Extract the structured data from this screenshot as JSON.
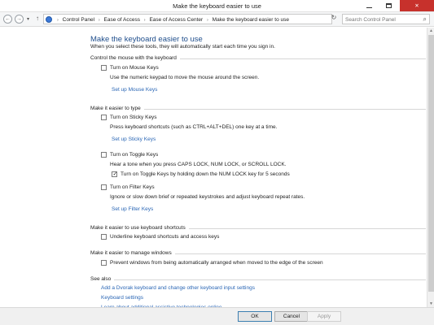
{
  "window": {
    "title": "Make the keyboard easier to use",
    "close_glyph": "✕"
  },
  "addressbar": {
    "back_glyph": "←",
    "forward_glyph": "→",
    "recent_glyph": "▾",
    "up_glyph": "↑",
    "breadcrumbs": [
      "Control Panel",
      "Ease of Access",
      "Ease of Access Center",
      "Make the keyboard easier to use"
    ],
    "separator": "›",
    "drop_glyph": "▾",
    "refresh_glyph": "↻",
    "search_placeholder": "Search Control Panel",
    "search_glyph": "⌕"
  },
  "page": {
    "title": "Make the keyboard easier to use",
    "subtitle": "When you select these tools, they will automatically start each time you sign in."
  },
  "sections": {
    "mouse": {
      "heading": "Control the mouse with the keyboard",
      "mouse_keys": {
        "label": "Turn on Mouse Keys",
        "checked": false
      },
      "mouse_keys_desc": "Use the numeric keypad to move the mouse around the screen.",
      "mouse_keys_link": "Set up Mouse Keys"
    },
    "typing": {
      "heading": "Make it easier to type",
      "sticky_keys": {
        "label": "Turn on Sticky Keys",
        "checked": false
      },
      "sticky_keys_desc": "Press keyboard shortcuts (such as CTRL+ALT+DEL) one key at a time.",
      "sticky_keys_link": "Set up Sticky Keys",
      "toggle_keys": {
        "label": "Turn on Toggle Keys",
        "checked": false
      },
      "toggle_keys_desc": "Hear a tone when you press CAPS LOCK, NUM LOCK, or SCROLL LOCK.",
      "toggle_keys_hold": {
        "label": "Turn on Toggle Keys by holding down the NUM LOCK key for 5 seconds",
        "checked": true
      },
      "filter_keys": {
        "label": "Turn on Filter Keys",
        "checked": false
      },
      "filter_keys_desc": "Ignore or slow down brief or repeated keystrokes and adjust keyboard repeat rates.",
      "filter_keys_link": "Set up Filter Keys"
    },
    "shortcuts": {
      "heading": "Make it easier to use keyboard shortcuts",
      "underline": {
        "label": "Underline keyboard shortcuts and access keys",
        "checked": false
      }
    },
    "windows": {
      "heading": "Make it easier to manage windows",
      "prevent_arrange": {
        "label": "Prevent windows from being automatically arranged when moved to the edge of the screen",
        "checked": false
      }
    },
    "see_also": {
      "heading": "See also",
      "links": [
        "Add a Dvorak keyboard and change other keyboard input settings",
        "Keyboard settings",
        "Learn about additional assistive technologies online"
      ]
    }
  },
  "buttons": {
    "ok": "OK",
    "cancel": "Cancel",
    "apply": "Apply"
  }
}
